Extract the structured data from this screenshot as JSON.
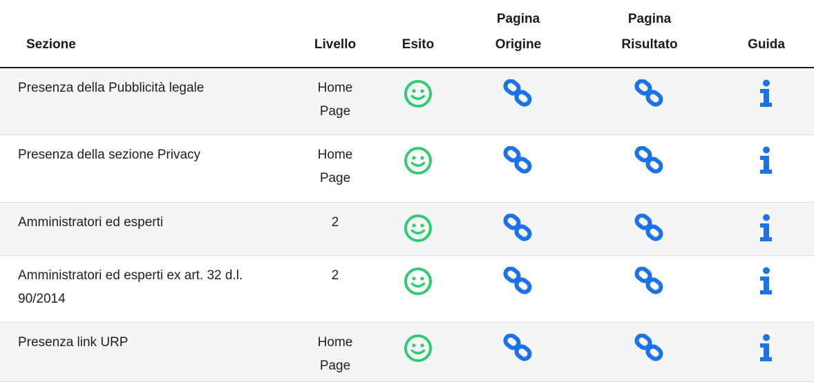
{
  "headers": {
    "sezione": "Sezione",
    "livello": "Livello",
    "esito": "Esito",
    "pagina_origine_line1": "Pagina",
    "pagina_origine_line2": "Origine",
    "pagina_risultato_line1": "Pagina",
    "pagina_risultato_line2": "Risultato",
    "guida": "Guida"
  },
  "rows": [
    {
      "sezione": "Presenza della Pubblicità legale",
      "livello_line1": "Home",
      "livello_line2": "Page",
      "esito": "smile-icon",
      "origine": "link-icon",
      "risultato": "link-icon",
      "guida": "info-icon"
    },
    {
      "sezione": "Presenza della sezione Privacy",
      "livello_line1": "Home",
      "livello_line2": "Page",
      "esito": "smile-icon",
      "origine": "link-icon",
      "risultato": "link-icon",
      "guida": "info-icon"
    },
    {
      "sezione": "Amministratori ed esperti",
      "livello_line1": "2",
      "livello_line2": "",
      "esito": "smile-icon",
      "origine": "link-icon",
      "risultato": "link-icon",
      "guida": "info-icon"
    },
    {
      "sezione": "Amministratori ed esperti ex art. 32 d.l. 90/2014",
      "livello_line1": "2",
      "livello_line2": "",
      "esito": "smile-icon",
      "origine": "link-icon",
      "risultato": "link-icon",
      "guida": "info-icon"
    },
    {
      "sezione": "Presenza link URP",
      "livello_line1": "Home",
      "livello_line2": "Page",
      "esito": "smile-icon",
      "origine": "link-icon",
      "risultato": "link-icon",
      "guida": "info-icon"
    }
  ],
  "colors": {
    "smile": "#2ecc71",
    "link": "#1a73e8",
    "info": "#1a73e8"
  }
}
